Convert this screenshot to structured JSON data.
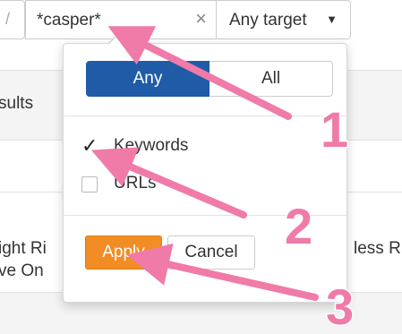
{
  "search": {
    "left_char": "/",
    "value": "*casper*",
    "clear_icon": "×"
  },
  "target_dropdown": {
    "label": "Any target",
    "caret": "▼"
  },
  "background": {
    "results_text": "sults",
    "row_line1": "ight Ri",
    "row_line2": "ve On",
    "right_text": "less R"
  },
  "filter_menu": {
    "match_any": "Any",
    "match_all": "All",
    "options": [
      {
        "label": "Keywords",
        "checked": true
      },
      {
        "label": "URLs",
        "checked": false
      }
    ],
    "apply_label": "Apply",
    "cancel_label": "Cancel"
  },
  "annotations": {
    "color": "#f07aa8",
    "numbers": [
      "1",
      "2",
      "3"
    ]
  },
  "colors": {
    "primary": "#1f5ba7",
    "apply": "#f28c24"
  }
}
